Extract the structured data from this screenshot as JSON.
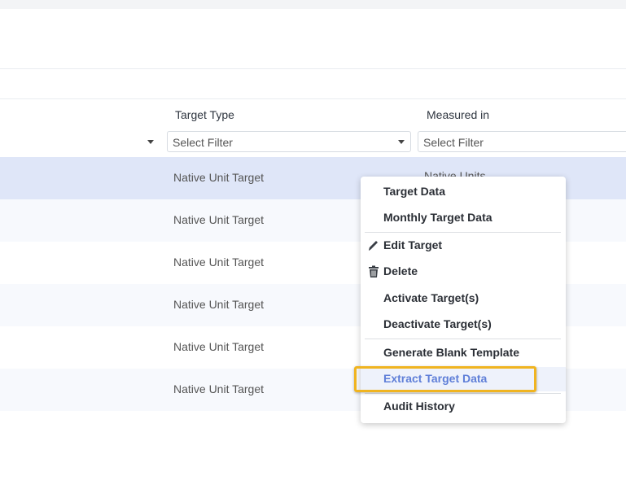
{
  "table": {
    "headers": {
      "target_type": "Target Type",
      "measured_in": "Measured in"
    },
    "filters": {
      "target_type": "Select Filter",
      "measured_in": "Select Filter"
    },
    "rows": [
      {
        "target_type": "Native Unit Target",
        "measured_in": "Native Units"
      },
      {
        "target_type": "Native Unit Target",
        "measured_in": ""
      },
      {
        "target_type": "Native Unit Target",
        "measured_in": ""
      },
      {
        "target_type": "Native Unit Target",
        "measured_in": ""
      },
      {
        "target_type": "Native Unit Target",
        "measured_in": ""
      },
      {
        "target_type": "Native Unit Target",
        "measured_in": ""
      }
    ]
  },
  "context_menu": {
    "items": [
      {
        "label": "Target Data",
        "icon": ""
      },
      {
        "label": "Monthly Target Data",
        "icon": ""
      },
      {
        "label": "Edit Target",
        "icon": "pencil-icon"
      },
      {
        "label": "Delete",
        "icon": "trash-icon"
      },
      {
        "label": "Activate Target(s)",
        "icon": ""
      },
      {
        "label": "Deactivate Target(s)",
        "icon": ""
      },
      {
        "label": "Generate Blank Template",
        "icon": ""
      },
      {
        "label": "Extract Target Data",
        "icon": "",
        "highlighted": true
      },
      {
        "label": "Audit History",
        "icon": ""
      }
    ]
  },
  "colors": {
    "selected_row": "#dfe6f8",
    "alt_row": "#f7f9fd",
    "highlight_border": "#f0b420",
    "highlight_text": "#5f7fd8"
  }
}
